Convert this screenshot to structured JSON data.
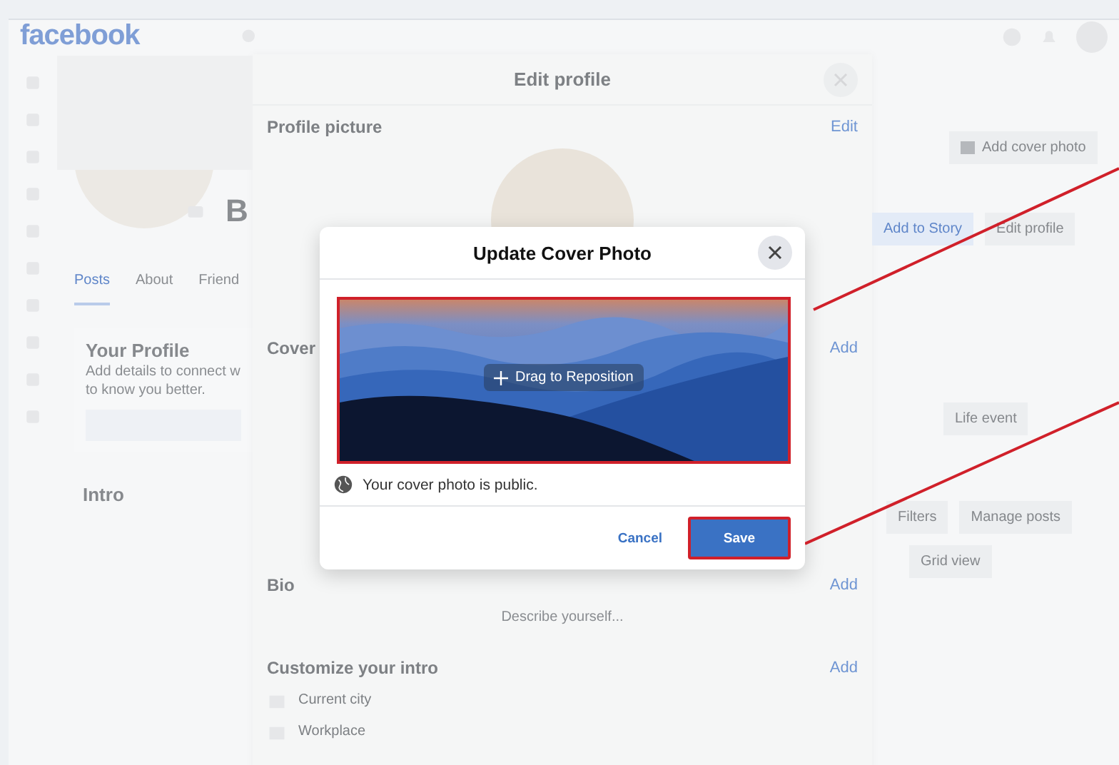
{
  "top_bar": {
    "logo": "facebook"
  },
  "profile": {
    "name": "B",
    "tabs": [
      {
        "label": "Posts",
        "selected": true
      },
      {
        "label": "About",
        "selected": false
      },
      {
        "label": "Friend",
        "selected": false
      }
    ],
    "card": {
      "title": "Your Profile",
      "lines": [
        "Add details to connect w",
        "to know you better."
      ]
    },
    "intro_title": "Intro"
  },
  "edit_profile": {
    "title": "Edit profile",
    "sections": [
      {
        "kind": "picture",
        "title": "Profile picture",
        "action": "Edit"
      },
      {
        "kind": "cover",
        "title": "Cover",
        "action": "Add"
      },
      {
        "kind": "bio",
        "title": "Bio",
        "action": "Add",
        "placeholder": "Describe yourself..."
      },
      {
        "kind": "intro",
        "title": "Customize your intro",
        "action": "Add",
        "items": [
          "Current city",
          "Workplace"
        ]
      }
    ]
  },
  "right_panel": {
    "cover_button": "Add cover photo",
    "buttons": [
      {
        "label": "Add to Story",
        "kind": "primary"
      },
      {
        "label": "Edit profile",
        "kind": "secondary"
      }
    ],
    "life_event": "Life event",
    "filters": "Filters",
    "manage_posts": "Manage posts",
    "grid_view": "Grid view"
  },
  "dialog": {
    "title": "Update Cover Photo",
    "drag_label": "Drag to Reposition",
    "privacy_note": "Your cover photo is public.",
    "buttons": [
      {
        "label": "Cancel",
        "kind": "secondary"
      },
      {
        "label": "Save",
        "kind": "primary"
      }
    ]
  }
}
